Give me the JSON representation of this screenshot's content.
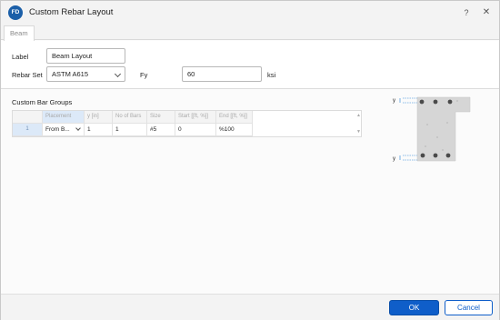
{
  "window": {
    "logo_text": "FD",
    "title": "Custom Rebar Layout",
    "help_glyph": "?",
    "close_glyph": "✕"
  },
  "tabs": [
    {
      "label": "Beam"
    }
  ],
  "form": {
    "label_caption": "Label",
    "label_value": "Beam Layout",
    "rebar_set_caption": "Rebar Set",
    "rebar_set_value": "ASTM A615",
    "fy_caption": "Fy",
    "fy_value": "60",
    "fy_unit": "ksi"
  },
  "groups": {
    "title": "Custom Bar Groups",
    "columns": [
      "Placement",
      "y [in]",
      "No of Bars",
      "Size",
      "Start [[ft, %]]",
      "End [[ft, %]]"
    ],
    "rows": [
      {
        "index": "1",
        "placement": "From B...",
        "y": "1",
        "no_of_bars": "1",
        "size": "#5",
        "start": "0",
        "end": "%100"
      }
    ]
  },
  "diagram": {
    "y_label": "y"
  },
  "footer": {
    "ok_label": "OK",
    "cancel_label": "Cancel"
  },
  "colors": {
    "accent": "#0f5ec9",
    "logo": "#1b5fa8",
    "selection": "#dce9f8",
    "concrete": "#d6d6d6",
    "bar": "#4a4a4a"
  }
}
